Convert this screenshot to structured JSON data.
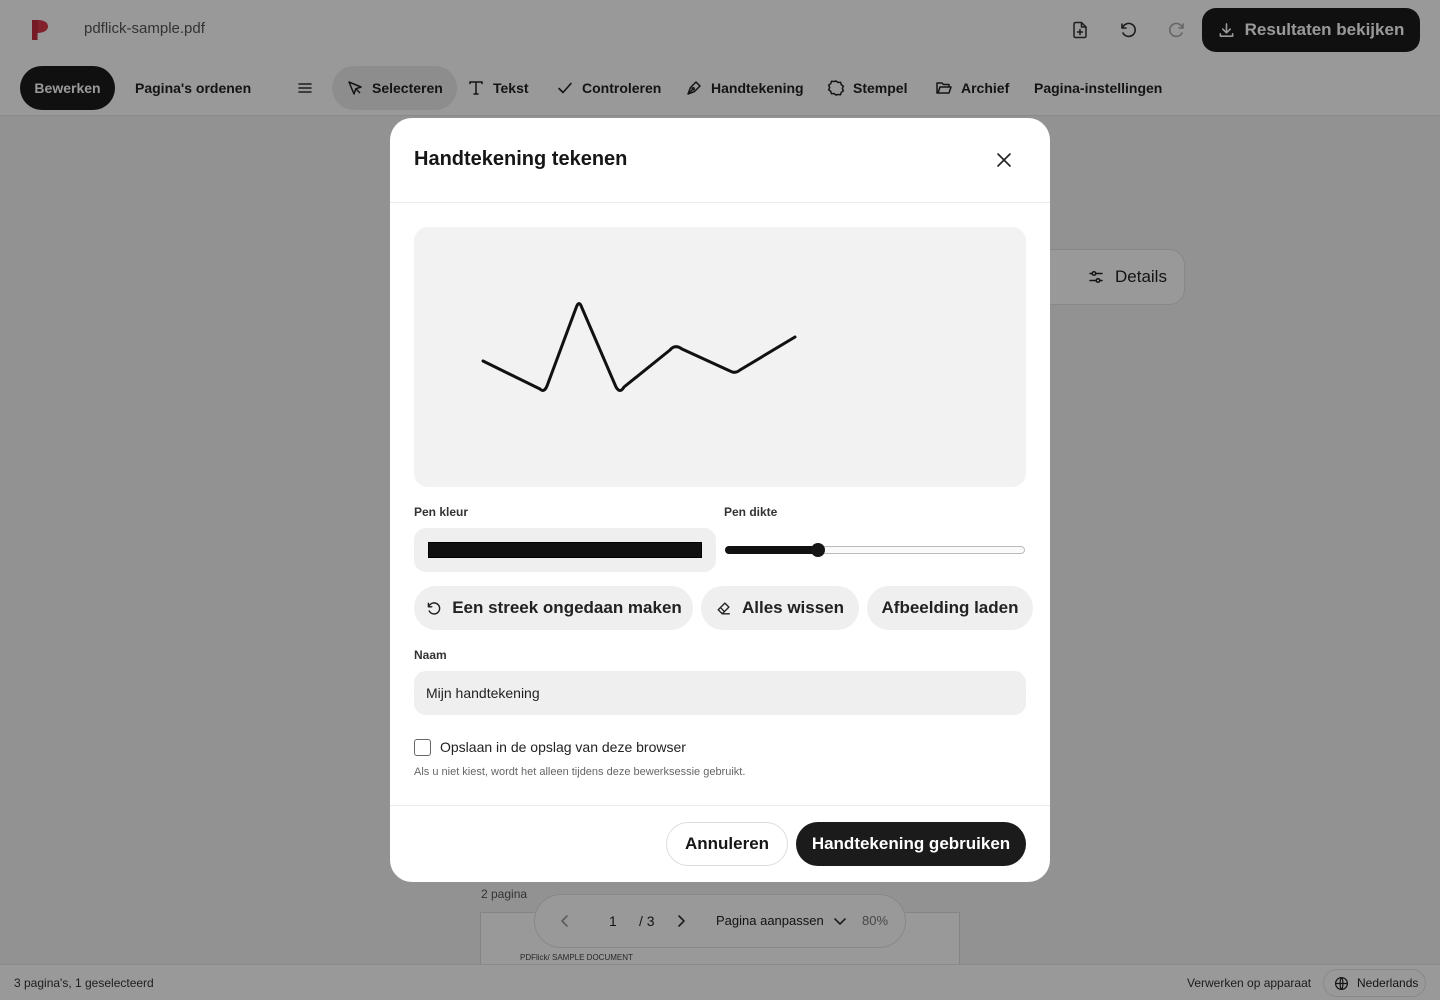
{
  "header": {
    "filename": "pdflick-sample.pdf",
    "results_button": "Resultaten bekijken"
  },
  "toolbar": {
    "mode_tabs": [
      "Bewerken",
      "Pagina's ordenen"
    ],
    "tools": [
      "Selecteren",
      "Tekst",
      "Controleren",
      "Handtekening",
      "Stempel",
      "Archief",
      "Pagina-instellingen"
    ],
    "active_tool": "Selecteren"
  },
  "workspace": {
    "details_label": "Details",
    "page_label": "2 pagina",
    "page_doc_text": "PDFlick/ SAMPLE DOCUMENT",
    "pager": {
      "current_page": "1",
      "total": "/ 3",
      "fit_label": "Pagina aanpassen",
      "zoom": "80%"
    }
  },
  "statusbar": {
    "selection_info": "3 pagina's, 1 geselecteerd",
    "processing": "Verwerken op apparaat",
    "language": "Nederlands"
  },
  "modal": {
    "title": "Handtekening tekenen",
    "pen_color_label": "Pen kleur",
    "pen_color": "#111111",
    "pen_width_label": "Pen dikte",
    "pen_width_fraction": 0.31,
    "undo_button": "Een streek ongedaan maken",
    "clear_button": "Alles wissen",
    "load_image_button": "Afbeelding laden",
    "name_label": "Naam",
    "name_value": "Mijn handtekening",
    "save_checkbox_label": "Opslaan in de opslag van deze browser",
    "save_checked": false,
    "hint": "Als u niet kiest, wordt het alleen tijdens deze bewerksessie gebruikt.",
    "cancel_button": "Annuleren",
    "use_button": "Handtekening gebruiken"
  },
  "colors": {
    "accent_dark": "#1b1b1b",
    "logo_red": "#d83a4a"
  }
}
